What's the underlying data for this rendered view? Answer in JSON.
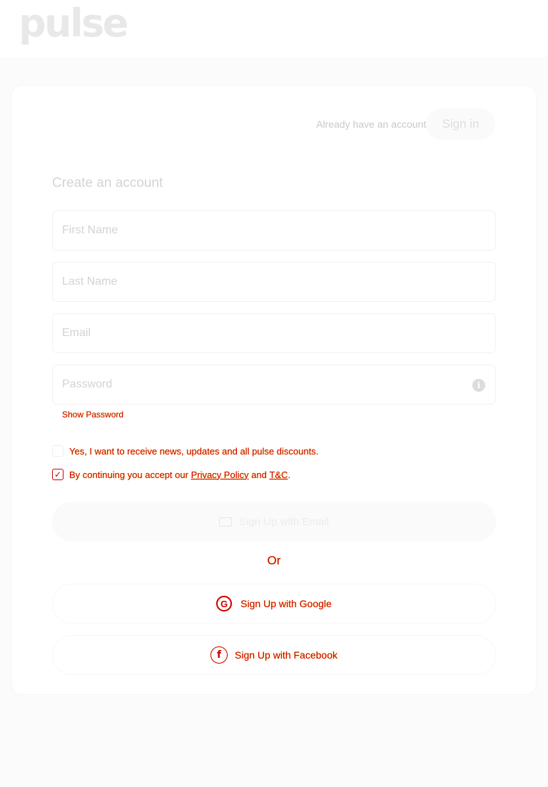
{
  "header": {
    "logo": "pulse"
  },
  "auth": {
    "prompt": "Already have an account?",
    "signin_label": "Sign in"
  },
  "form": {
    "title": "Create an account",
    "first_name_placeholder": "First Name",
    "last_name_placeholder": "Last Name",
    "email_placeholder": "Email",
    "password_placeholder": "Password",
    "info_icon": "i",
    "show_password": "Show Password",
    "newsletter": {
      "label": "Yes, I want to receive news, updates and all pulse discounts.",
      "checked": false
    },
    "terms": {
      "prefix": "By continuing you accept our",
      "privacy": "Privacy Policy",
      "and": "and",
      "tnc": "T&C",
      "suffix": ".",
      "checked": true
    },
    "submit_label": "Sign Up with Email",
    "or": "Or",
    "google": {
      "icon": "G",
      "label": "Sign Up with Google"
    },
    "facebook": {
      "icon": "f",
      "label": "Sign Up with Facebook"
    }
  }
}
